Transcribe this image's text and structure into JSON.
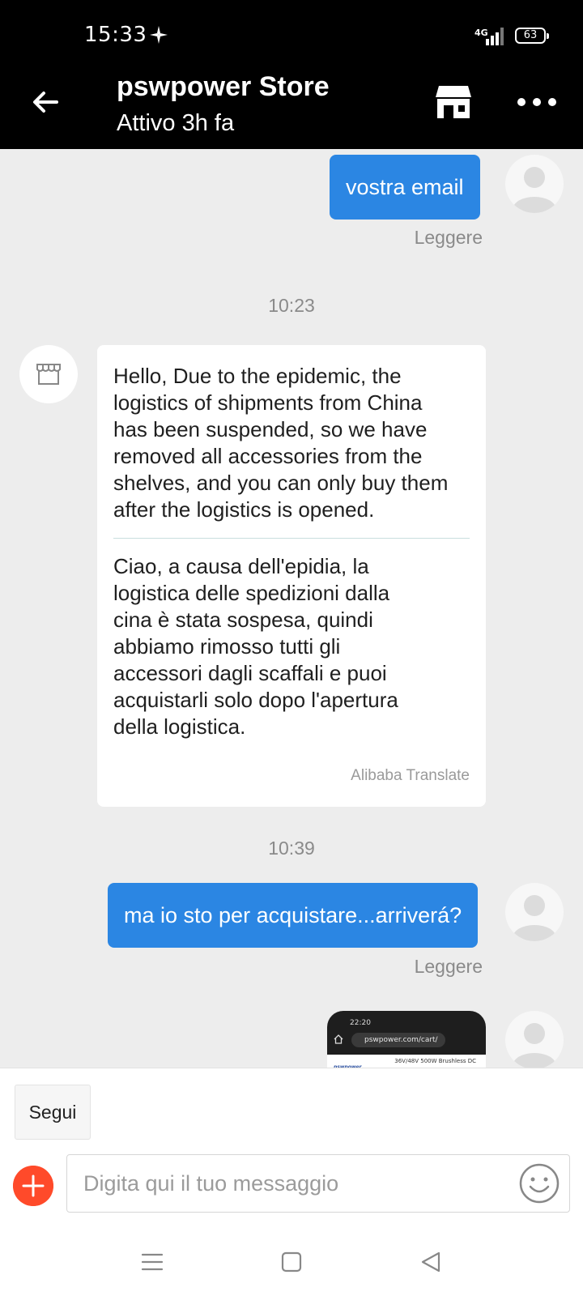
{
  "status_bar": {
    "time": "15:33",
    "network": "4G",
    "battery": "63"
  },
  "header": {
    "store_name": "pswpower Store",
    "status": "Attivo 3h fa"
  },
  "messages": {
    "out1": {
      "text": "vostra email",
      "receipt": "Leggere"
    },
    "time1": "10:23",
    "in1": {
      "original": "Hello, Due to the epidemic, the\nlogistics of shipments from China\nhas been suspended, so we have\nremoved all accessories from the\nshelves, and you can only buy them\nafter the logistics is opened.",
      "translation": "Ciao, a causa dell'epidia, la\nlogistica delle spedizioni dalla\ncina è stata sospesa, quindi\nabbiamo rimosso tutti gli\naccessori dagli scaffali e puoi\nacquistarli solo dopo l'apertura\ndella logistica.",
      "credit": "Alibaba Translate"
    },
    "time2": "10:39",
    "out2": {
      "text": "ma io sto per acquistare...arriverá?",
      "receipt": "Leggere"
    },
    "screenshot": {
      "time": "22:20",
      "url": "pswpower.com/cart/",
      "caption": "36V/48V 500W Brushless DC",
      "logo": "pswpower"
    }
  },
  "composer": {
    "follow_label": "Segui",
    "placeholder": "Digita qui il tuo messaggio"
  },
  "colors": {
    "accent_blue": "#2b86e3",
    "plus_red": "#ff4a2a",
    "background": "#ededed"
  }
}
